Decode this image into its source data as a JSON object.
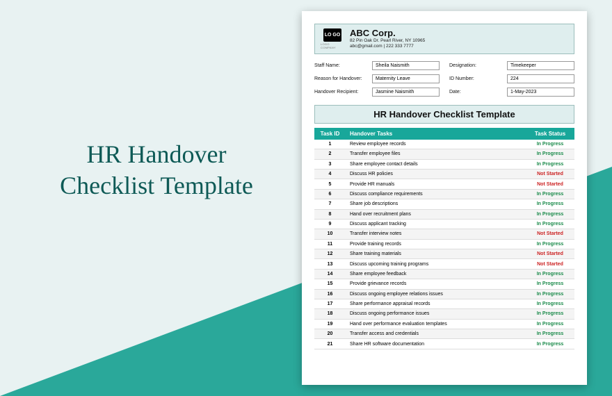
{
  "hero": {
    "title": "HR Handover Checklist Template"
  },
  "company": {
    "logo_text": "LO GO",
    "logo_sub": "LOGO COMPANY",
    "name": "ABC Corp.",
    "address": "82 Pin Oak Dr. Pearl River, NY 10965",
    "contact": "abc@gmail.com | 222 333 7777"
  },
  "fields": {
    "left": [
      {
        "label": "Staff Name:",
        "value": "Sheila Naismith"
      },
      {
        "label": "Reason for Handover:",
        "value": "Maternity Leave"
      },
      {
        "label": "Handover Recipient:",
        "value": "Jasmine Naismith"
      }
    ],
    "right": [
      {
        "label": "Designation:",
        "value": "Timekeeper"
      },
      {
        "label": "ID Number:",
        "value": "224"
      },
      {
        "label": "Date:",
        "value": "1-May-2023"
      }
    ]
  },
  "section_title": "HR Handover Checklist Template",
  "table": {
    "headers": {
      "id": "Task ID",
      "task": "Handover Tasks",
      "status": "Task Status"
    },
    "rows": [
      {
        "id": "1",
        "task": "Review employee records",
        "status": "In Progress",
        "cls": "st-ip"
      },
      {
        "id": "2",
        "task": "Transfer employee files",
        "status": "In Progress",
        "cls": "st-ip"
      },
      {
        "id": "3",
        "task": "Share employee contact details",
        "status": "In Progress",
        "cls": "st-ip"
      },
      {
        "id": "4",
        "task": "Discuss HR policies",
        "status": "Not Started",
        "cls": "st-ns"
      },
      {
        "id": "5",
        "task": "Provide HR manuals",
        "status": "Not Started",
        "cls": "st-ns"
      },
      {
        "id": "6",
        "task": "Discuss compliance requirements",
        "status": "In Progress",
        "cls": "st-ip"
      },
      {
        "id": "7",
        "task": "Share job descriptions",
        "status": "In Progress",
        "cls": "st-ip"
      },
      {
        "id": "8",
        "task": "Hand over recruitment plans",
        "status": "In Progress",
        "cls": "st-ip"
      },
      {
        "id": "9",
        "task": "Discuss applicant tracking",
        "status": "In Progress",
        "cls": "st-ip"
      },
      {
        "id": "10",
        "task": "Transfer interview notes",
        "status": "Not Started",
        "cls": "st-ns"
      },
      {
        "id": "11",
        "task": "Provide training records",
        "status": "In Progress",
        "cls": "st-ip"
      },
      {
        "id": "12",
        "task": "Share training materials",
        "status": "Not Started",
        "cls": "st-ns"
      },
      {
        "id": "13",
        "task": "Discuss upcoming training programs",
        "status": "Not Started",
        "cls": "st-ns"
      },
      {
        "id": "14",
        "task": "Share employee feedback",
        "status": "In Progress",
        "cls": "st-ip"
      },
      {
        "id": "15",
        "task": "Provide grievance records",
        "status": "In Progress",
        "cls": "st-ip"
      },
      {
        "id": "16",
        "task": "Discuss ongoing employee relations issues",
        "status": "In Progress",
        "cls": "st-ip"
      },
      {
        "id": "17",
        "task": "Share performance appraisal records",
        "status": "In Progress",
        "cls": "st-ip"
      },
      {
        "id": "18",
        "task": "Discuss ongoing performance issues",
        "status": "In Progress",
        "cls": "st-ip"
      },
      {
        "id": "19",
        "task": "Hand over performance evaluation templates",
        "status": "In Progress",
        "cls": "st-ip"
      },
      {
        "id": "20",
        "task": "Transfer access and credentials",
        "status": "In Progress",
        "cls": "st-ip"
      },
      {
        "id": "21",
        "task": "Share HR software documentation",
        "status": "In Progress",
        "cls": "st-ip"
      }
    ]
  }
}
